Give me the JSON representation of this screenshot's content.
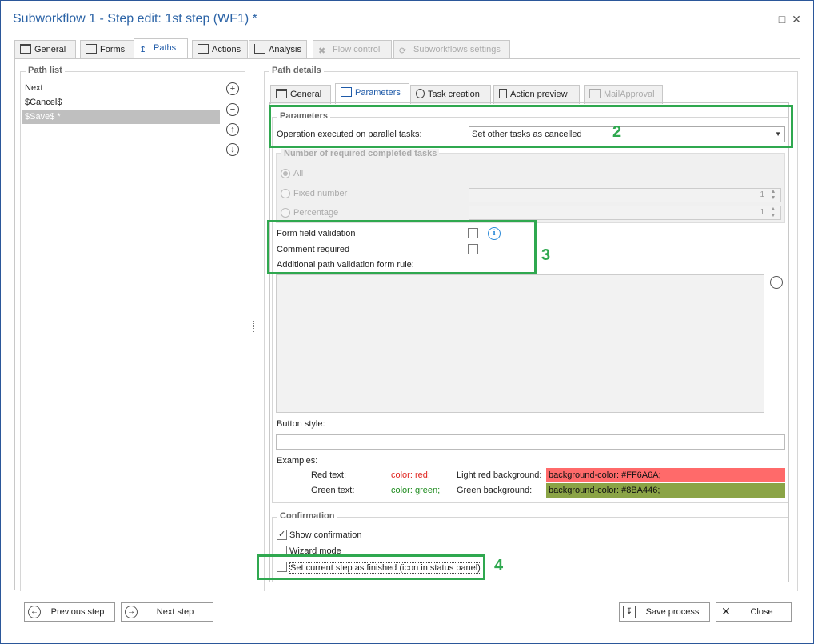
{
  "window": {
    "title": "Subworkflow 1 - Step edit: 1st step (WF1) *"
  },
  "top_tabs": [
    {
      "label": "General"
    },
    {
      "label": "Forms"
    },
    {
      "label": "Paths"
    },
    {
      "label": "Actions"
    },
    {
      "label": "Analysis"
    },
    {
      "label": "Flow control"
    },
    {
      "label": "Subworkflows settings"
    }
  ],
  "path_list": {
    "title": "Path list",
    "items": [
      "Next",
      "$Cancel$",
      "$Save$ *"
    ]
  },
  "path_details": {
    "title": "Path details",
    "tabs": [
      {
        "label": "General"
      },
      {
        "label": "Parameters"
      },
      {
        "label": "Task creation"
      },
      {
        "label": "Action preview"
      },
      {
        "label": "MailApproval"
      }
    ],
    "parameters": {
      "title": "Parameters",
      "operation_label": "Operation executed on parallel tasks:",
      "operation_value": "Set other tasks as cancelled"
    },
    "required_tasks": {
      "title": "Number of required completed tasks",
      "all": "All",
      "fixed": "Fixed number",
      "fixed_value": "1",
      "percentage": "Percentage",
      "percentage_value": "1"
    },
    "validation": {
      "form_field": "Form field validation",
      "comment": "Comment required",
      "additional_rule": "Additional path validation form rule:"
    },
    "button_style_label": "Button style:",
    "examples": {
      "label": "Examples:",
      "red_text": "Red text:",
      "red_code": "color: red;",
      "light_red_bg": "Light red background:",
      "light_red_code": "background-color: #FF6A6A;",
      "green_text": "Green text:",
      "green_code": "color: green;",
      "green_bg": "Green background:",
      "green_bg_code": "background-color: #8BA446;"
    },
    "confirmation": {
      "title": "Confirmation",
      "show": "Show confirmation",
      "show_checked": true,
      "wizard": "Wizard mode",
      "finished": "Set current step as finished (icon in status panel)"
    }
  },
  "annotations": [
    "2",
    "3",
    "4"
  ],
  "footer": {
    "prev": "Previous step",
    "next": "Next step",
    "save": "Save process",
    "close": "Close"
  },
  "colors": {
    "accent": "#2b63a6",
    "annotation": "#2fa84f",
    "light_red": "#FF6A6A",
    "green_bg": "#8BA446"
  }
}
